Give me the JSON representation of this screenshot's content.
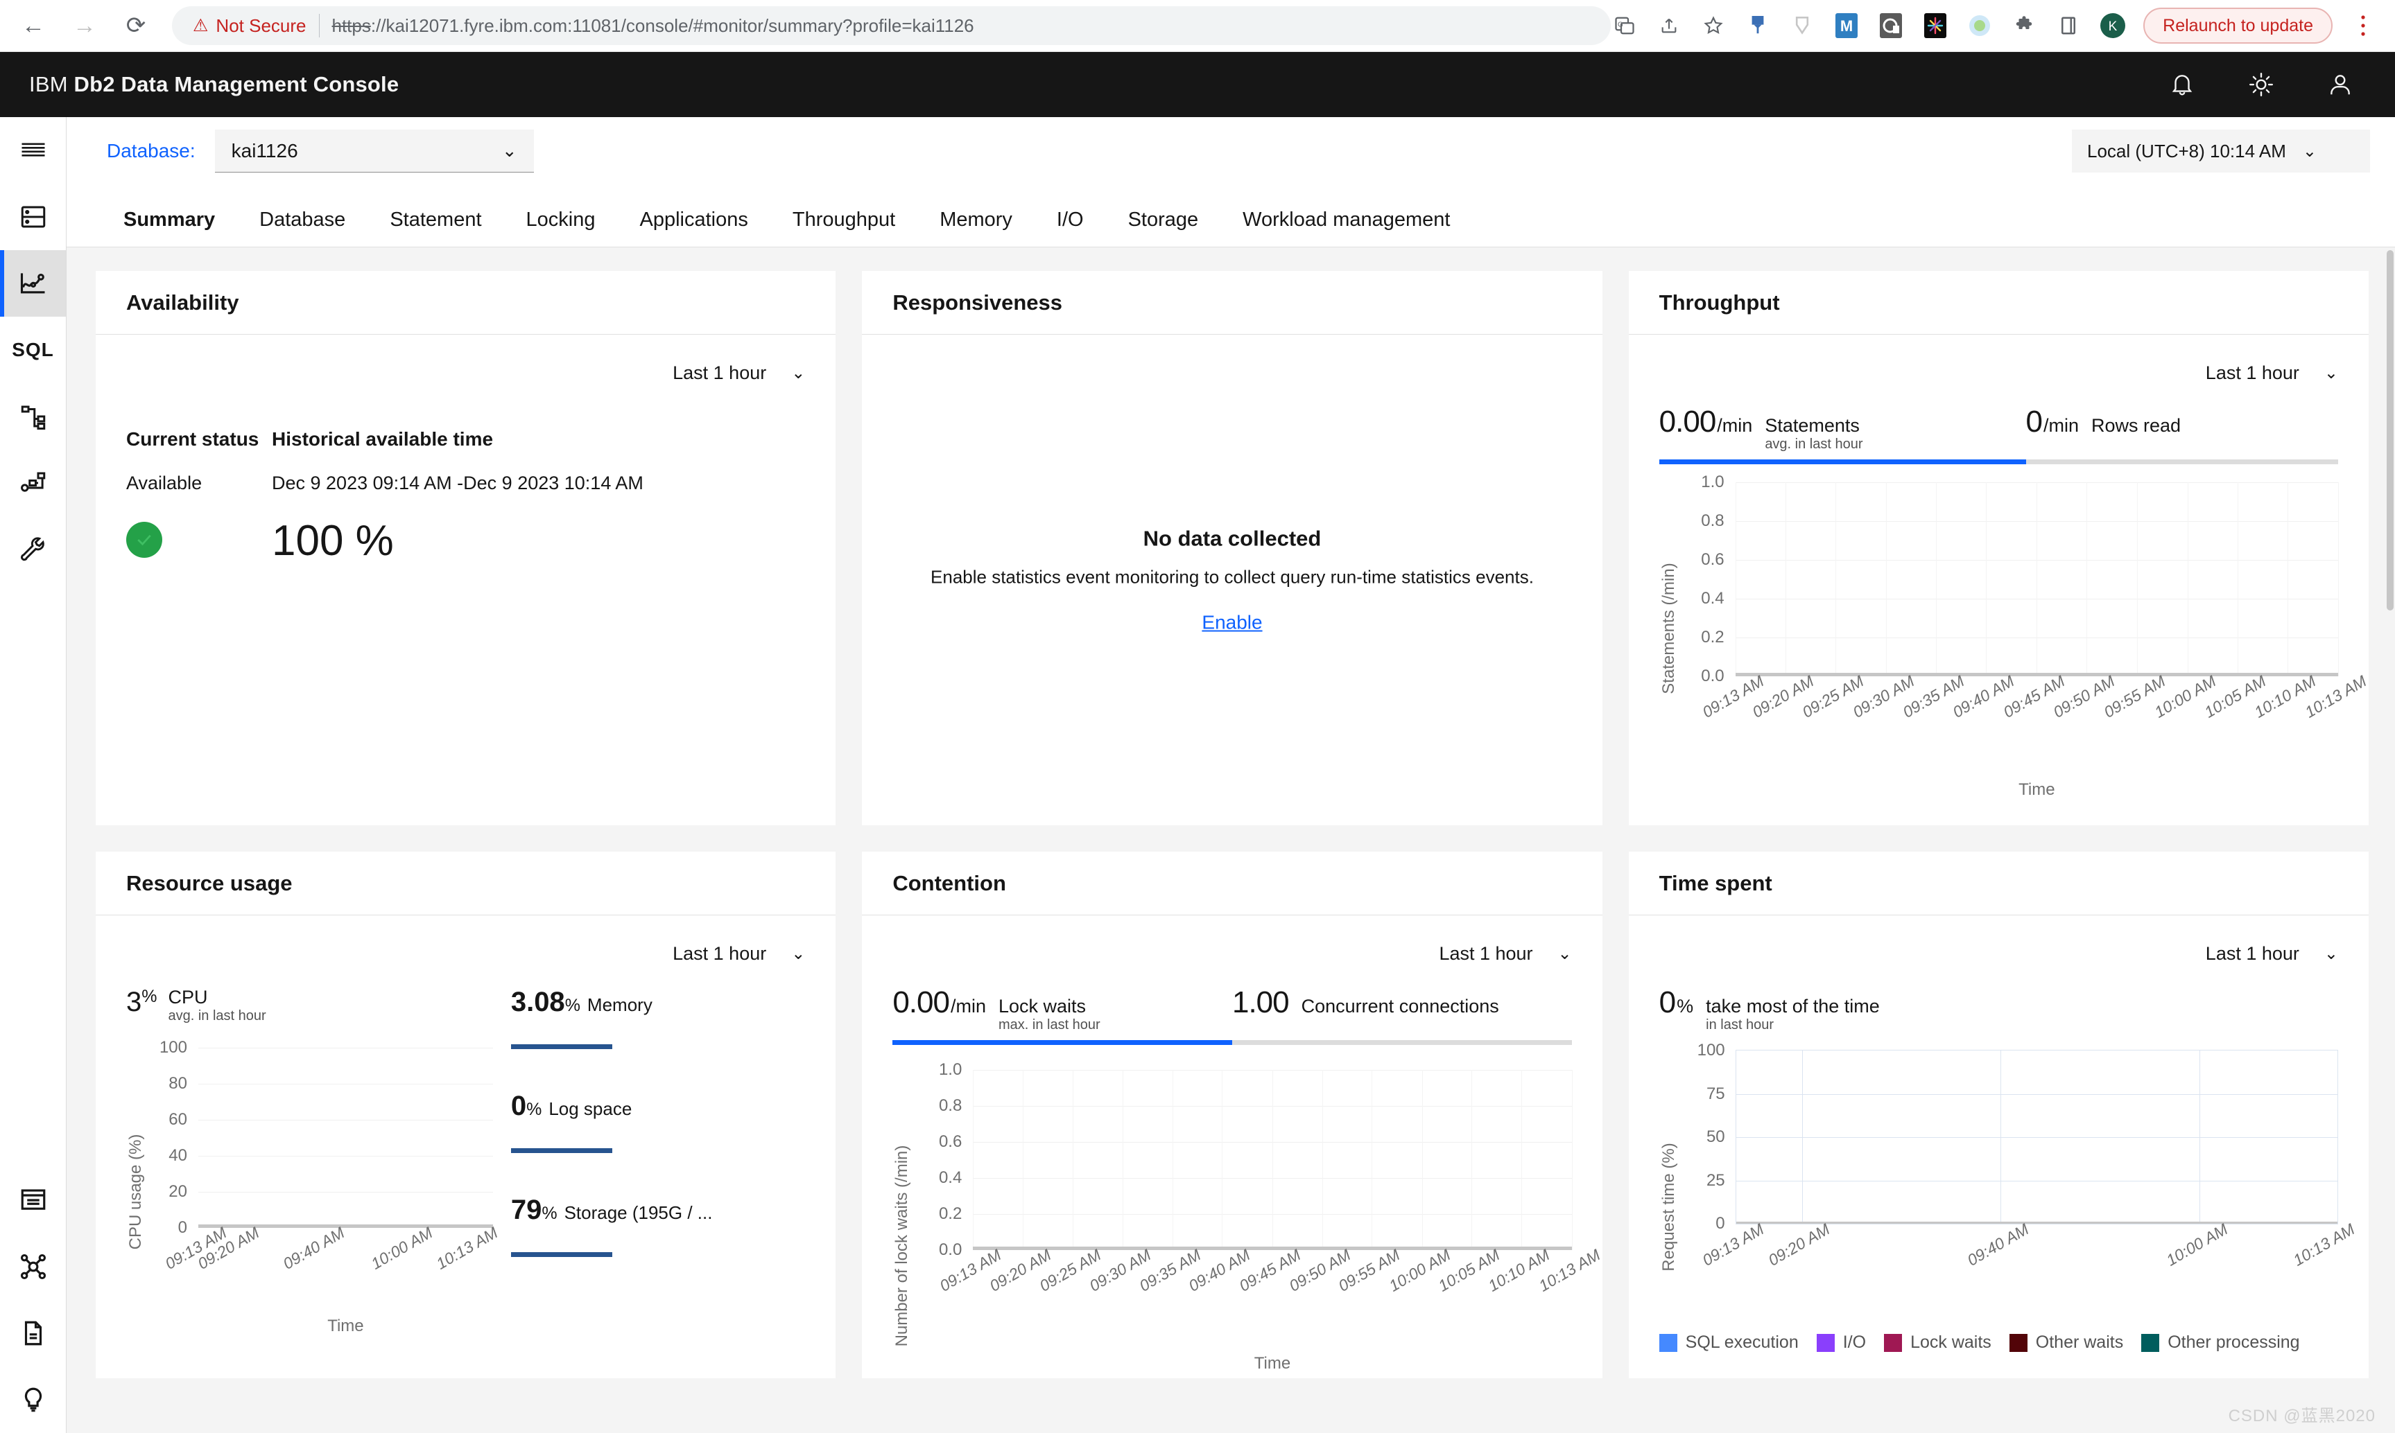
{
  "browser": {
    "back_icon": "back-arrow-icon",
    "forward_icon": "forward-arrow-icon",
    "reload_icon": "reload-icon",
    "security_label": "Not Secure",
    "url_scheme": "https",
    "url_rest": "://kai12071.fyre.ibm.com:11081/console/#monitor/summary?profile=kai1126",
    "url_host": "kai12071.fyre.ibm.com",
    "url_port": ":11081",
    "url_path": "/console/#monitor/summary?profile=kai1126",
    "relaunch_label": "Relaunch to update",
    "profile_initial": "K",
    "toolbar_icons": [
      "translate-icon",
      "share-icon",
      "bookmark-star-icon",
      "extension-pin-icon",
      "extension-shield-icon",
      "extension-m-icon",
      "extension-c-icon",
      "extension-burst-icon",
      "extension-circle-icon",
      "puzzle-extensions-icon",
      "side-panel-icon"
    ]
  },
  "app": {
    "brand_prefix": "IBM",
    "brand_name": "Db2 Data Management Console",
    "header_icons": [
      "notification-bell-icon",
      "theme-brightness-icon",
      "user-account-icon"
    ]
  },
  "rail": {
    "items": [
      {
        "name": "menu-hamburger-icon",
        "label": "Menu"
      },
      {
        "name": "database-icon",
        "label": "Database"
      },
      {
        "name": "monitor-chart-icon",
        "label": "Monitor",
        "active": true
      },
      {
        "name": "sql-icon",
        "label": "SQL"
      },
      {
        "name": "explain-plan-icon",
        "label": "Explain"
      },
      {
        "name": "workload-icon",
        "label": "Workload"
      },
      {
        "name": "wrench-settings-icon",
        "label": "Settings"
      }
    ],
    "bottom_items": [
      {
        "name": "console-window-icon",
        "label": "Console"
      },
      {
        "name": "connections-hub-icon",
        "label": "Connections"
      },
      {
        "name": "document-icon",
        "label": "Documentation"
      },
      {
        "name": "lightbulb-tips-icon",
        "label": "Tips"
      }
    ]
  },
  "toolbar": {
    "database_label": "Database:",
    "database_value": "kai1126",
    "timezone_value": "Local (UTC+8) 10:14 AM"
  },
  "tabs": [
    {
      "label": "Summary",
      "active": true
    },
    {
      "label": "Database",
      "active": false
    },
    {
      "label": "Statement",
      "active": false
    },
    {
      "label": "Locking",
      "active": false
    },
    {
      "label": "Applications",
      "active": false
    },
    {
      "label": "Throughput",
      "active": false
    },
    {
      "label": "Memory",
      "active": false
    },
    {
      "label": "I/O",
      "active": false
    },
    {
      "label": "Storage",
      "active": false
    },
    {
      "label": "Workload management",
      "active": false
    }
  ],
  "cards": {
    "availability": {
      "title": "Availability",
      "range": "Last 1 hour",
      "col1_header": "Current status",
      "col1_value": "Available",
      "col2_header": "Historical available time",
      "col2_value": "Dec 9 2023 09:14 AM -Dec 9 2023 10:14 AM",
      "percent": "100 %",
      "status_color": "#24a148"
    },
    "responsiveness": {
      "title": "Responsiveness",
      "empty_title": "No data collected",
      "empty_subtitle": "Enable statistics event monitoring to collect query run-time statistics events.",
      "empty_action": "Enable"
    },
    "throughput": {
      "title": "Throughput",
      "range": "Last 1 hour",
      "kpi1_value": "0.00",
      "kpi1_unit": "/min",
      "kpi1_label": "Statements",
      "kpi1_sub": "avg. in last hour",
      "kpi2_value": "0",
      "kpi2_unit": "/min",
      "kpi2_label": "Rows read"
    },
    "resource_usage": {
      "title": "Resource usage",
      "range": "Last 1 hour",
      "cpu_value": "3",
      "cpu_pct": "%",
      "cpu_label": "CPU",
      "cpu_sub": "avg. in last hour",
      "items": [
        {
          "value": "3.08",
          "pct": "%",
          "label": "Memory"
        },
        {
          "value": "0",
          "pct": "%",
          "label": "Log space"
        },
        {
          "value": "79",
          "pct": "%",
          "label": "Storage (195G / ..."
        }
      ]
    },
    "contention": {
      "title": "Contention",
      "range": "Last 1 hour",
      "kpi1_value": "0.00",
      "kpi1_unit": "/min",
      "kpi1_label": "Lock waits",
      "kpi1_sub": "max. in last hour",
      "kpi2_value": "1.00",
      "kpi2_label": "Concurrent connections"
    },
    "time_spent": {
      "title": "Time spent",
      "range": "Last 1 hour",
      "kpi_value": "0",
      "kpi_pct": "%",
      "kpi_label": "take most of the time",
      "kpi_sub": "in last hour"
    }
  },
  "chart_data": [
    {
      "id": "throughput-chart",
      "type": "line",
      "title": "",
      "xlabel": "Time",
      "ylabel": "Statements (/min)",
      "ylim": [
        0,
        1.0
      ],
      "yticks": [
        "0.0",
        "0.2",
        "0.4",
        "0.6",
        "0.8",
        "1.0"
      ],
      "x": [
        "09:13 AM",
        "09:20 AM",
        "09:25 AM",
        "09:30 AM",
        "09:35 AM",
        "09:40 AM",
        "09:45 AM",
        "09:50 AM",
        "09:55 AM",
        "10:00 AM",
        "10:05 AM",
        "10:10 AM",
        "10:13 AM"
      ],
      "series": [
        {
          "name": "Statements",
          "values": [
            0,
            0,
            0,
            0,
            0,
            0,
            0,
            0,
            0,
            0,
            0,
            0,
            0
          ],
          "color": "#c6c6c6"
        }
      ],
      "grid": true
    },
    {
      "id": "cpu-chart",
      "type": "line",
      "title": "",
      "xlabel": "Time",
      "ylabel": "CPU usage (%)",
      "ylim": [
        0,
        100
      ],
      "yticks": [
        "0",
        "20",
        "40",
        "60",
        "80",
        "100"
      ],
      "x": [
        "09:13 AM",
        "09:20 AM",
        "09:40 AM",
        "10:00 AM",
        "10:13 AM"
      ],
      "series": [
        {
          "name": "CPU usage",
          "values": [
            0,
            0,
            0,
            0,
            0
          ],
          "color": "#c6c6c6"
        }
      ],
      "grid": true
    },
    {
      "id": "lock-waits-chart",
      "type": "line",
      "title": "",
      "xlabel": "Time",
      "ylabel": "Number of lock waits (/min)",
      "ylim": [
        0,
        1.0
      ],
      "yticks": [
        "0.0",
        "0.2",
        "0.4",
        "0.6",
        "0.8",
        "1.0"
      ],
      "x": [
        "09:13 AM",
        "09:20 AM",
        "09:25 AM",
        "09:30 AM",
        "09:35 AM",
        "09:40 AM",
        "09:45 AM",
        "09:50 AM",
        "09:55 AM",
        "10:00 AM",
        "10:05 AM",
        "10:10 AM",
        "10:13 AM"
      ],
      "series": [
        {
          "name": "Lock waits",
          "values": [
            0,
            0,
            0,
            0,
            0,
            0,
            0,
            0,
            0,
            0,
            0,
            0,
            0
          ],
          "color": "#c6c6c6"
        }
      ],
      "grid": true
    },
    {
      "id": "time-spent-chart",
      "type": "area",
      "title": "",
      "xlabel": "",
      "ylabel": "Request time (%)",
      "ylim": [
        0,
        100
      ],
      "yticks": [
        "0",
        "25",
        "50",
        "75",
        "100"
      ],
      "x": [
        "09:13 AM",
        "09:20 AM",
        "09:40 AM",
        "10:00 AM",
        "10:13 AM"
      ],
      "series": [
        {
          "name": "SQL execution",
          "values": [
            0,
            0,
            0,
            0,
            0
          ],
          "color": "#4589ff"
        },
        {
          "name": "I/O",
          "values": [
            0,
            0,
            0,
            0,
            0
          ],
          "color": "#8a3ffc"
        },
        {
          "name": "Lock waits",
          "values": [
            0,
            0,
            0,
            0,
            0
          ],
          "color": "#9f1853"
        },
        {
          "name": "Other waits",
          "values": [
            0,
            0,
            0,
            0,
            0
          ],
          "color": "#520408"
        },
        {
          "name": "Other processing",
          "values": [
            0,
            0,
            0,
            0,
            0
          ],
          "color": "#005d5d"
        }
      ],
      "legend_position": "bottom",
      "grid": true
    }
  ],
  "watermark": "CSDN @蓝黑2020"
}
